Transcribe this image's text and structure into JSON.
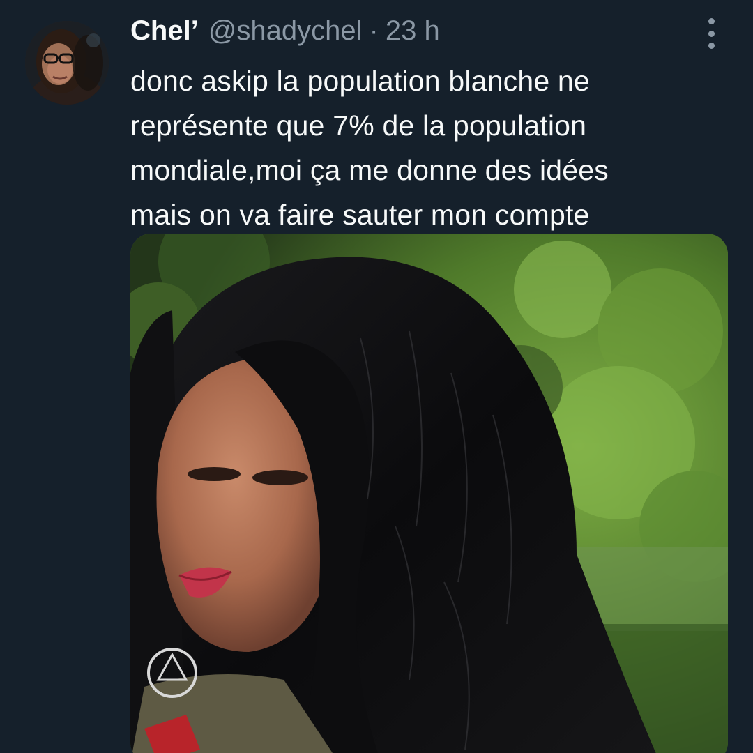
{
  "tweet": {
    "author": {
      "display_name": "Chel’",
      "handle": "@shadychel",
      "avatar_icon": "profile-photo"
    },
    "separator": "·",
    "timestamp": "23 h",
    "more_icon": "more-vertical-icon",
    "text_lines": [
      "donc askip la population blanche ne",
      "représente que 7% de la population",
      "mondiale,moi ça me donne des idées",
      "mais on va faire sauter mon compte"
    ],
    "media": {
      "type": "photo"
    }
  },
  "colors": {
    "background": "#15202b",
    "primary_text": "#f7f9f9",
    "secondary_text": "#8b98a5"
  }
}
